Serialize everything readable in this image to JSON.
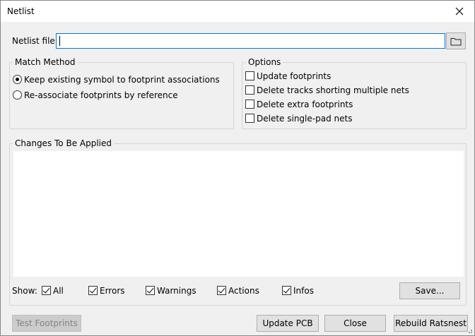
{
  "window": {
    "title": "Netlist"
  },
  "netlist_file": {
    "label": "Netlist file:",
    "value": ""
  },
  "match_method": {
    "title": "Match Method",
    "options": [
      {
        "label": "Keep existing symbol to footprint associations",
        "selected": true
      },
      {
        "label": "Re-associate footprints by reference",
        "selected": false
      }
    ]
  },
  "options": {
    "title": "Options",
    "items": [
      {
        "label": "Update footprints",
        "checked": false
      },
      {
        "label": "Delete tracks shorting multiple nets",
        "checked": false
      },
      {
        "label": "Delete extra footprints",
        "checked": false
      },
      {
        "label": "Delete single-pad nets",
        "checked": false
      }
    ]
  },
  "changes": {
    "title": "Changes To Be Applied",
    "show_label": "Show:",
    "filters": [
      {
        "label": "All",
        "checked": true
      },
      {
        "label": "Errors",
        "checked": true
      },
      {
        "label": "Warnings",
        "checked": true
      },
      {
        "label": "Actions",
        "checked": true
      },
      {
        "label": "Infos",
        "checked": true
      }
    ],
    "save_label": "Save..."
  },
  "buttons": {
    "test_footprints": "Test Footprints",
    "update_pcb": "Update PCB",
    "close": "Close",
    "rebuild_ratsnest": "Rebuild Ratsnest"
  }
}
